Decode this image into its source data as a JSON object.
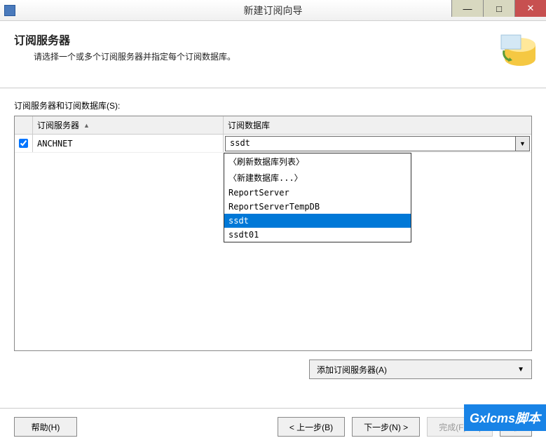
{
  "window": {
    "title": "新建订阅向导",
    "minimize": "—",
    "maximize": "□",
    "close": "✕"
  },
  "header": {
    "title": "订阅服务器",
    "subtitle": "请选择一个或多个订阅服务器并指定每个订阅数据库。"
  },
  "section_label": "订阅服务器和订阅数据库(S):",
  "grid": {
    "col_server": "订阅服务器",
    "col_database": "订阅数据库",
    "row": {
      "checked": true,
      "server": "ANCHNET",
      "database": "ssdt"
    }
  },
  "dropdown": {
    "items": [
      "〈刷新数据库列表〉",
      "〈新建数据库...〉",
      "ReportServer",
      "ReportServerTempDB",
      "ssdt",
      "ssdt01"
    ],
    "selected_index": 4
  },
  "add_server_btn": "添加订阅服务器(A)",
  "footer": {
    "help": "帮助(H)",
    "back": "< 上一步(B)",
    "next": "下一步(N) >",
    "finish": "完成(F) >>|",
    "cancel": "取"
  },
  "watermark": "Gxlcms脚本"
}
